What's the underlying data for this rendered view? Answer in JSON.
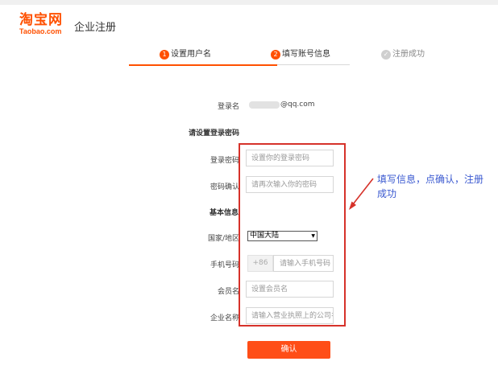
{
  "header": {
    "logo_main": "淘宝网",
    "logo_sub": "Taobao.com",
    "page_title": "企业注册"
  },
  "steps": [
    {
      "number": "1",
      "label": "设置用户名",
      "state": "active"
    },
    {
      "number": "2",
      "label": "填写账号信息",
      "state": "active"
    },
    {
      "number": "✓",
      "label": "注册成功",
      "state": "pending"
    }
  ],
  "form": {
    "login_name_label": "登录名",
    "login_name_value": "@qq.com",
    "password_section": "请设置登录密码",
    "password_label": "登录密码",
    "password_placeholder": "设置你的登录密码",
    "confirm_label": "密码确认",
    "confirm_placeholder": "请再次输入你的密码",
    "basic_section": "基本信息",
    "country_label": "国家/地区",
    "country_value": "中国大陆",
    "phone_label": "手机号码",
    "phone_prefix": "+86",
    "phone_placeholder": "请输入手机号码",
    "member_label": "会员名",
    "member_placeholder": "设置会员名",
    "company_label": "企业名称",
    "company_placeholder": "请输入营业执照上的公司名称",
    "submit_label": "确认"
  },
  "annotation": {
    "text": "填写信息，点确认，注册成功"
  },
  "colors": {
    "brand": "#ff5000",
    "highlight": "#d6322a",
    "annotation": "#3a59d0"
  }
}
